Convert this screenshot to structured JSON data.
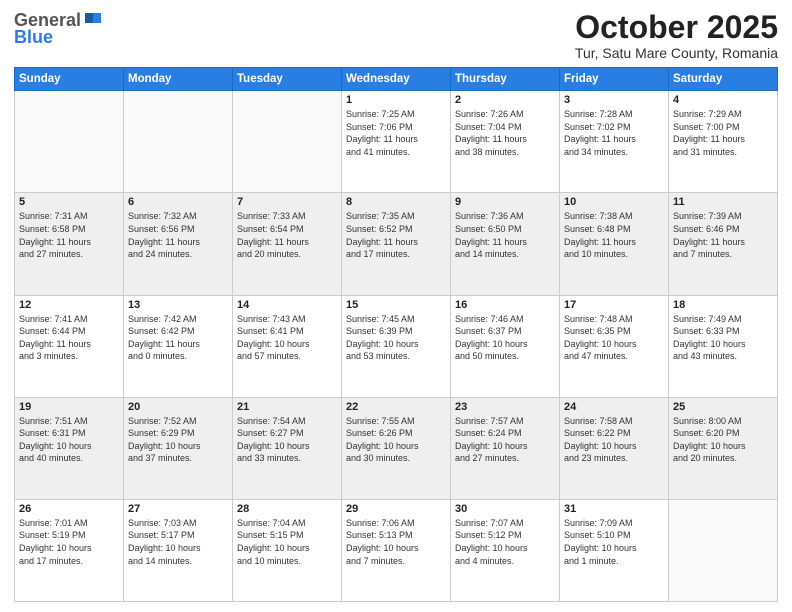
{
  "header": {
    "logo_general": "General",
    "logo_blue": "Blue",
    "title": "October 2025",
    "subtitle": "Tur, Satu Mare County, Romania"
  },
  "days_of_week": [
    "Sunday",
    "Monday",
    "Tuesday",
    "Wednesday",
    "Thursday",
    "Friday",
    "Saturday"
  ],
  "weeks": [
    {
      "shaded": false,
      "days": [
        {
          "num": "",
          "info": ""
        },
        {
          "num": "",
          "info": ""
        },
        {
          "num": "",
          "info": ""
        },
        {
          "num": "1",
          "info": "Sunrise: 7:25 AM\nSunset: 7:06 PM\nDaylight: 11 hours\nand 41 minutes."
        },
        {
          "num": "2",
          "info": "Sunrise: 7:26 AM\nSunset: 7:04 PM\nDaylight: 11 hours\nand 38 minutes."
        },
        {
          "num": "3",
          "info": "Sunrise: 7:28 AM\nSunset: 7:02 PM\nDaylight: 11 hours\nand 34 minutes."
        },
        {
          "num": "4",
          "info": "Sunrise: 7:29 AM\nSunset: 7:00 PM\nDaylight: 11 hours\nand 31 minutes."
        }
      ]
    },
    {
      "shaded": true,
      "days": [
        {
          "num": "5",
          "info": "Sunrise: 7:31 AM\nSunset: 6:58 PM\nDaylight: 11 hours\nand 27 minutes."
        },
        {
          "num": "6",
          "info": "Sunrise: 7:32 AM\nSunset: 6:56 PM\nDaylight: 11 hours\nand 24 minutes."
        },
        {
          "num": "7",
          "info": "Sunrise: 7:33 AM\nSunset: 6:54 PM\nDaylight: 11 hours\nand 20 minutes."
        },
        {
          "num": "8",
          "info": "Sunrise: 7:35 AM\nSunset: 6:52 PM\nDaylight: 11 hours\nand 17 minutes."
        },
        {
          "num": "9",
          "info": "Sunrise: 7:36 AM\nSunset: 6:50 PM\nDaylight: 11 hours\nand 14 minutes."
        },
        {
          "num": "10",
          "info": "Sunrise: 7:38 AM\nSunset: 6:48 PM\nDaylight: 11 hours\nand 10 minutes."
        },
        {
          "num": "11",
          "info": "Sunrise: 7:39 AM\nSunset: 6:46 PM\nDaylight: 11 hours\nand 7 minutes."
        }
      ]
    },
    {
      "shaded": false,
      "days": [
        {
          "num": "12",
          "info": "Sunrise: 7:41 AM\nSunset: 6:44 PM\nDaylight: 11 hours\nand 3 minutes."
        },
        {
          "num": "13",
          "info": "Sunrise: 7:42 AM\nSunset: 6:42 PM\nDaylight: 11 hours\nand 0 minutes."
        },
        {
          "num": "14",
          "info": "Sunrise: 7:43 AM\nSunset: 6:41 PM\nDaylight: 10 hours\nand 57 minutes."
        },
        {
          "num": "15",
          "info": "Sunrise: 7:45 AM\nSunset: 6:39 PM\nDaylight: 10 hours\nand 53 minutes."
        },
        {
          "num": "16",
          "info": "Sunrise: 7:46 AM\nSunset: 6:37 PM\nDaylight: 10 hours\nand 50 minutes."
        },
        {
          "num": "17",
          "info": "Sunrise: 7:48 AM\nSunset: 6:35 PM\nDaylight: 10 hours\nand 47 minutes."
        },
        {
          "num": "18",
          "info": "Sunrise: 7:49 AM\nSunset: 6:33 PM\nDaylight: 10 hours\nand 43 minutes."
        }
      ]
    },
    {
      "shaded": true,
      "days": [
        {
          "num": "19",
          "info": "Sunrise: 7:51 AM\nSunset: 6:31 PM\nDaylight: 10 hours\nand 40 minutes."
        },
        {
          "num": "20",
          "info": "Sunrise: 7:52 AM\nSunset: 6:29 PM\nDaylight: 10 hours\nand 37 minutes."
        },
        {
          "num": "21",
          "info": "Sunrise: 7:54 AM\nSunset: 6:27 PM\nDaylight: 10 hours\nand 33 minutes."
        },
        {
          "num": "22",
          "info": "Sunrise: 7:55 AM\nSunset: 6:26 PM\nDaylight: 10 hours\nand 30 minutes."
        },
        {
          "num": "23",
          "info": "Sunrise: 7:57 AM\nSunset: 6:24 PM\nDaylight: 10 hours\nand 27 minutes."
        },
        {
          "num": "24",
          "info": "Sunrise: 7:58 AM\nSunset: 6:22 PM\nDaylight: 10 hours\nand 23 minutes."
        },
        {
          "num": "25",
          "info": "Sunrise: 8:00 AM\nSunset: 6:20 PM\nDaylight: 10 hours\nand 20 minutes."
        }
      ]
    },
    {
      "shaded": false,
      "days": [
        {
          "num": "26",
          "info": "Sunrise: 7:01 AM\nSunset: 5:19 PM\nDaylight: 10 hours\nand 17 minutes."
        },
        {
          "num": "27",
          "info": "Sunrise: 7:03 AM\nSunset: 5:17 PM\nDaylight: 10 hours\nand 14 minutes."
        },
        {
          "num": "28",
          "info": "Sunrise: 7:04 AM\nSunset: 5:15 PM\nDaylight: 10 hours\nand 10 minutes."
        },
        {
          "num": "29",
          "info": "Sunrise: 7:06 AM\nSunset: 5:13 PM\nDaylight: 10 hours\nand 7 minutes."
        },
        {
          "num": "30",
          "info": "Sunrise: 7:07 AM\nSunset: 5:12 PM\nDaylight: 10 hours\nand 4 minutes."
        },
        {
          "num": "31",
          "info": "Sunrise: 7:09 AM\nSunset: 5:10 PM\nDaylight: 10 hours\nand 1 minute."
        },
        {
          "num": "",
          "info": ""
        }
      ]
    }
  ]
}
